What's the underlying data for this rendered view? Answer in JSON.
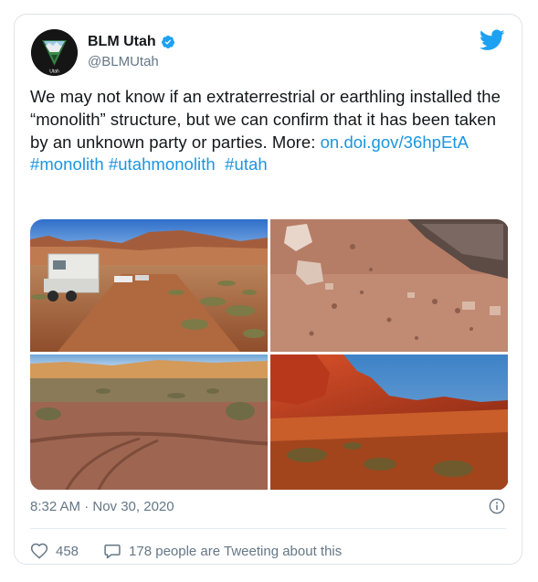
{
  "author": {
    "display_name": "BLM Utah",
    "handle": "@BLMUtah",
    "logo_text": "Utah"
  },
  "tweet": {
    "text_main": "We may not know if an extraterrestrial or earthling installed the “monolith” structure, but we can confirm that it has been taken by an unknown party or parties. More: ",
    "link": "on.doi.gov/36hpEtA",
    "hashtag_1": "#monolith",
    "hashtag_2": "#utahmonolith",
    "hashtag_3": "#utah"
  },
  "media": {
    "photos": [
      {
        "name": "camper-on-dirt-road"
      },
      {
        "name": "rocky-ground-closeup"
      },
      {
        "name": "tire-tracks-desert"
      },
      {
        "name": "red-rock-cliffs-sunset"
      }
    ]
  },
  "meta": {
    "timestamp": "8:32 AM · Nov 30, 2020"
  },
  "actions": {
    "likes": "458",
    "conversation": "178 people are Tweeting about this"
  },
  "colors": {
    "link": "#1b95e0",
    "secondary_text": "#657786",
    "verified": "#1da1f2",
    "twitter_blue": "#1da1f2"
  },
  "icons": [
    "verified-badge-icon",
    "twitter-bird-icon",
    "info-icon",
    "heart-icon",
    "speech-bubble-icon"
  ]
}
